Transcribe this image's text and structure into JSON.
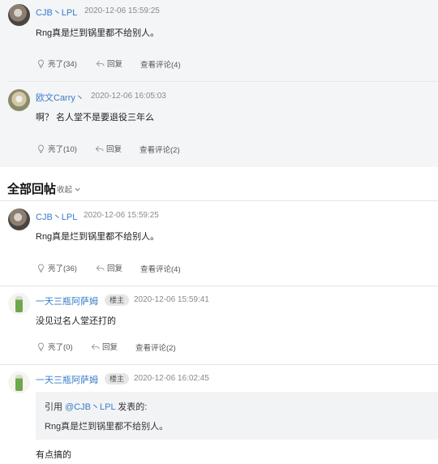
{
  "hot_replies": [
    {
      "username": "CJB丶LPL",
      "timestamp": "2020-12-06 15:59:25",
      "content": "Rng真是烂到锅里都不给别人。",
      "like": "亮了(34)",
      "reply": "回复",
      "view_comments": "查看评论(4)"
    },
    {
      "username": "欧文Carry丶",
      "timestamp": "2020-12-06 16:05:03",
      "content": "啊？ 名人堂不是要退役三年么",
      "like": "亮了(10)",
      "reply": "回复",
      "view_comments": "查看评论(2)"
    }
  ],
  "all_replies_section": {
    "title": "全部回帖",
    "collapse_label": "收起"
  },
  "all_replies": [
    {
      "username": "CJB丶LPL",
      "timestamp": "2020-12-06 15:59:25",
      "content": "Rng真是烂到锅里都不给别人。",
      "like": "亮了(36)",
      "reply": "回复",
      "view_comments": "查看评论(4)"
    },
    {
      "username": "一天三瓶阿萨姆",
      "badge": "楼主",
      "timestamp": "2020-12-06 15:59:41",
      "content": "没见过名人堂还打的",
      "like": "亮了(0)",
      "reply": "回复",
      "view_comments": "查看评论(2)"
    },
    {
      "username": "一天三瓶阿萨姆",
      "badge": "楼主",
      "timestamp": "2020-12-06 16:02:45",
      "quote_prefix": "引用 ",
      "quote_user": "@CJB丶LPL",
      "quote_suffix": " 发表的:",
      "quote_content": "Rng真是烂到锅里都不给别人。",
      "content": "有点搞的"
    }
  ],
  "colors": {
    "username": "#3a7cc8",
    "hot_background": "#f4f5f7",
    "quote_background": "#f2f3f5"
  },
  "icons": [
    "bulb-icon",
    "reply-arrow-icon",
    "chevron-down-icon"
  ]
}
